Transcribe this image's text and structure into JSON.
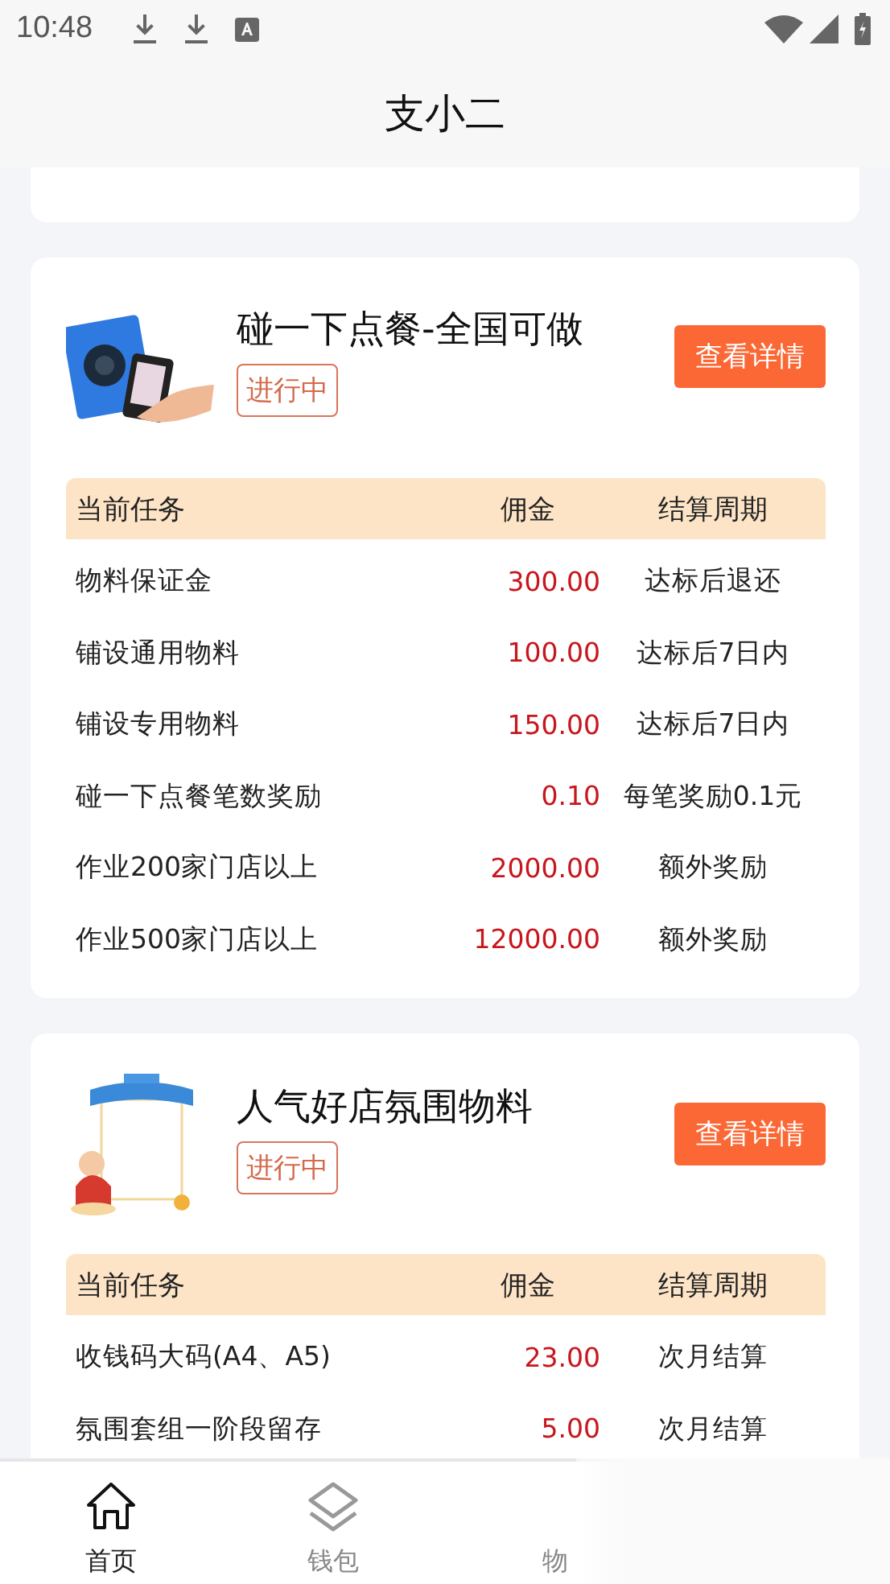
{
  "status_bar": {
    "time": "10:48"
  },
  "app_bar": {
    "title": "支小二"
  },
  "tasks": [
    {
      "title": "碰一下点餐-全国可做",
      "status": "进行中",
      "button": "查看详情",
      "image": {
        "kind": "picture"
      },
      "columns": [
        "当前任务",
        "佣金",
        "结算周期"
      ],
      "rows": [
        {
          "task": "物料保证金",
          "commission": "300.00",
          "period": "达标后退还"
        },
        {
          "task": "铺设通用物料",
          "commission": "100.00",
          "period": "达标后7日内"
        },
        {
          "task": "铺设专用物料",
          "commission": "150.00",
          "period": "达标后7日内"
        },
        {
          "task": "碰一下点餐笔数奖励",
          "commission": "0.10",
          "period": "每笔奖励0.1元"
        },
        {
          "task": "作业200家门店以上",
          "commission": "2000.00",
          "period": "额外奖励"
        },
        {
          "task": "作业500家门店以上",
          "commission": "12000.00",
          "period": "额外奖励"
        }
      ]
    },
    {
      "title": "人气好店氛围物料",
      "status": "进行中",
      "button": "查看详情",
      "image": {
        "kind": "picture"
      },
      "columns": [
        "当前任务",
        "佣金",
        "结算周期"
      ],
      "rows": [
        {
          "task": "收钱码大码(A4、A5)",
          "commission": "23.00",
          "period": "次月结算"
        },
        {
          "task": "氛围套组一阶段留存",
          "commission": "5.00",
          "period": "次月结算"
        }
      ]
    }
  ],
  "bottom_nav": [
    {
      "label": "首页",
      "kind": "home",
      "selected": true
    },
    {
      "label": "钱包",
      "kind": "layers",
      "selected": false
    },
    {
      "label": "物",
      "kind": "text",
      "selected": false
    }
  ]
}
